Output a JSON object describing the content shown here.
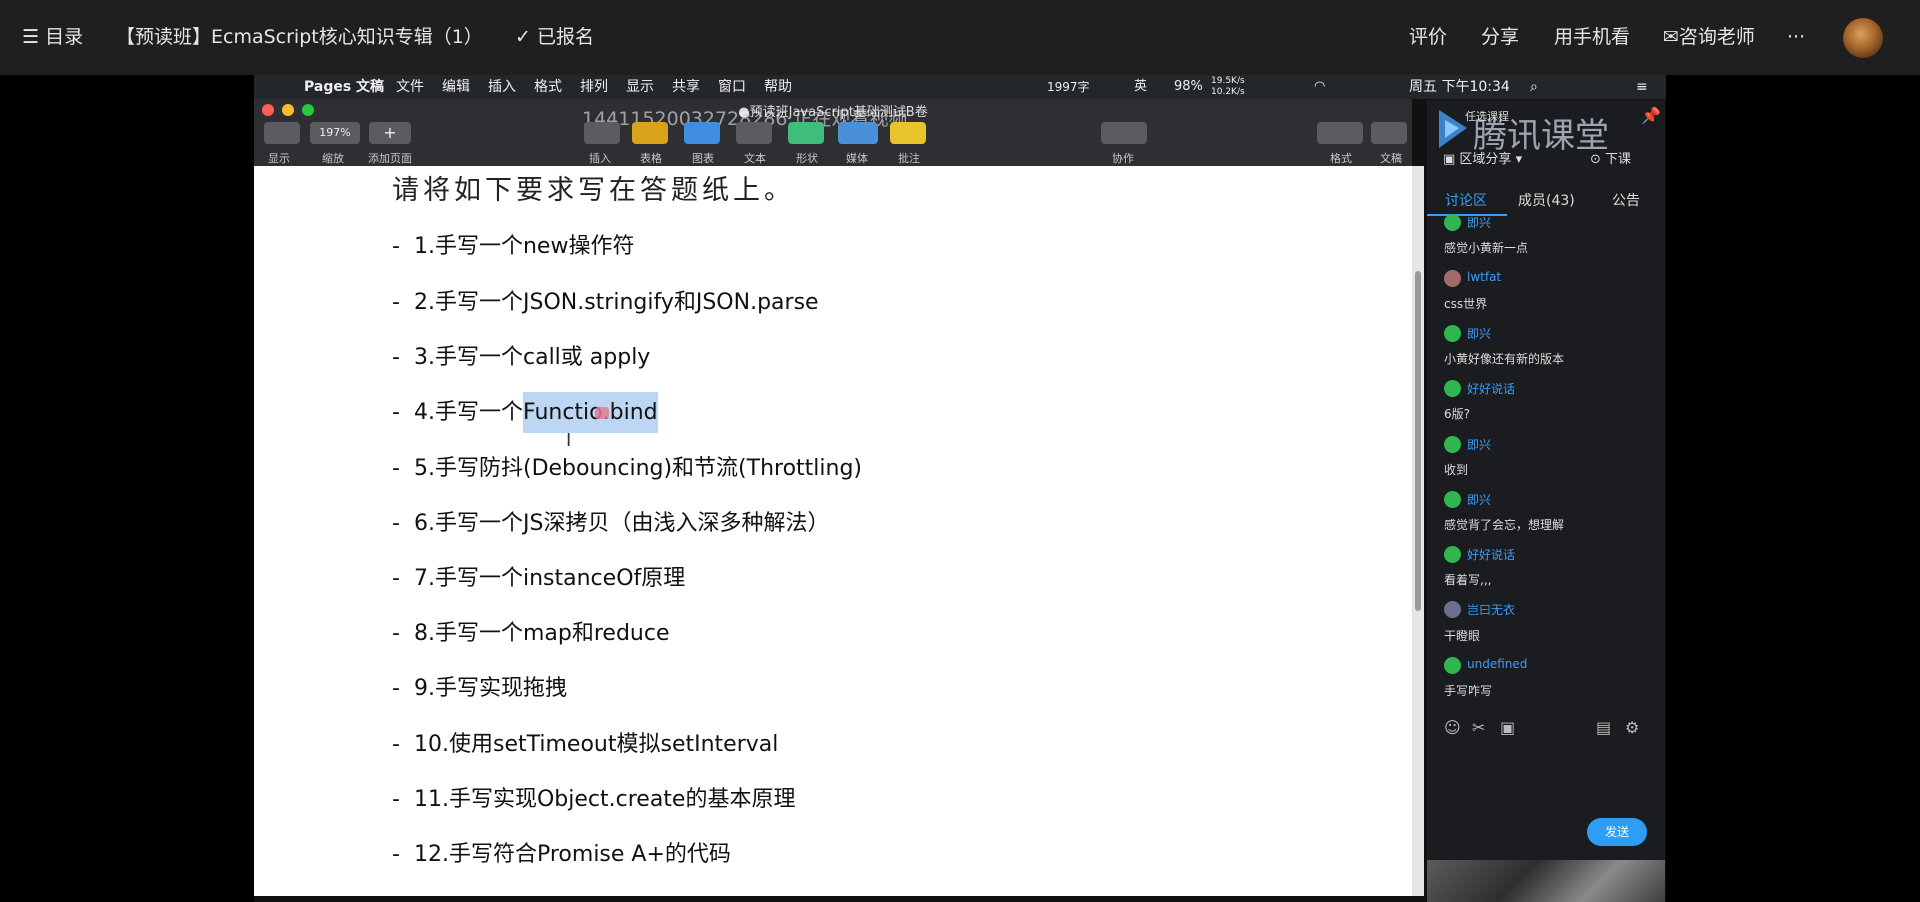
{
  "topbar": {
    "menu_label": "☰ 目录",
    "course_title": "【预读班】EcmaScript核心知识专辑（1）",
    "enrolled": "✓ 已报名",
    "actions": [
      "评价",
      "分享",
      "用手机看",
      "咨询老师",
      "···"
    ]
  },
  "mac": {
    "menubar": [
      "Pages 文稿",
      "文件",
      "编辑",
      "插入",
      "格式",
      "排列",
      "显示",
      "共享",
      "窗口",
      "帮助"
    ],
    "status": {
      "word_count": "1997字",
      "battery": "98%",
      "net_up": "19.5K/s",
      "net_down": "10.2K/s",
      "input": "英",
      "clock": "周五 下午10:34"
    },
    "window_title": "●预读班JavaScript基础测试B卷",
    "watermark": "14411520032728286 正在观看视频",
    "toolbar": {
      "zoom": "197%",
      "labels": [
        "显示",
        "缩放",
        "添加页面",
        "插入",
        "表格",
        "图表",
        "文本",
        "形状",
        "媒体",
        "批注",
        "协作",
        "格式",
        "文稿"
      ]
    }
  },
  "doc": {
    "heading": "请将如下要求写在答题纸上。",
    "items": [
      "1.手写一个new操作符",
      "2.手写一个JSON.stringify和JSON.parse",
      "3.手写一个call或 apply",
      "4.手写一个",
      "5.手写防抖(Debouncing)和节流(Throttling)",
      "6.手写一个JS深拷贝（由浅入深多种解法）",
      "7.手写一个instanceOf原理",
      "8.手写一个map和reduce",
      "9.手写实现拖拽",
      "10.使用setTimeout模拟setInterval",
      "11.手写实现Object.create的基本原理",
      "12.手写符合Promise A+的代码"
    ],
    "highlight_a": "Functio",
    "highlight_b": ".bind",
    "dash": "-"
  },
  "panel": {
    "logo": "腾讯课堂",
    "share_label": "区域分享",
    "end_label": "下课",
    "choose": "任选课程",
    "tabs": [
      "讨论区",
      "成员(43)",
      "公告"
    ],
    "messages": [
      {
        "name": "即兴",
        "text": "感觉小黄新一点"
      },
      {
        "name": "lwtfat",
        "text": "css世界"
      },
      {
        "name": "即兴",
        "text": "小黄好像还有新的版本"
      },
      {
        "name": "好好说话",
        "text": "6版?"
      },
      {
        "name": "即兴",
        "text": "收到"
      },
      {
        "name": "即兴",
        "text": "感觉背了会忘，想理解"
      },
      {
        "name": "好好说话",
        "text": "看着写,,,"
      },
      {
        "name": "岂曰无衣",
        "text": "干瞪眼"
      },
      {
        "name": "undefined",
        "text": "手写咋写"
      }
    ],
    "send": "发送"
  }
}
